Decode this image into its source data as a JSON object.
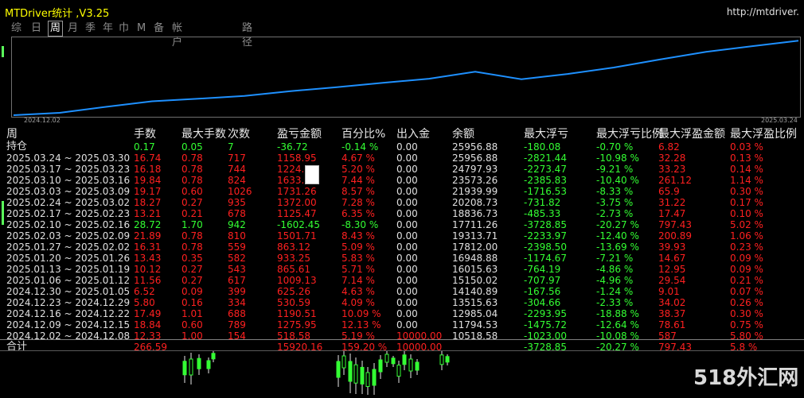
{
  "app": {
    "title": "MTDriver统计 ,V3.25",
    "url": "http://mtdriver."
  },
  "tabs": [
    {
      "label": "综",
      "active": false
    },
    {
      "label": "日",
      "active": false
    },
    {
      "label": "周",
      "active": true
    },
    {
      "label": "月",
      "active": false
    },
    {
      "label": "季",
      "active": false
    },
    {
      "label": "年",
      "active": false
    },
    {
      "label": "巾",
      "active": false
    },
    {
      "label": "M",
      "active": false
    },
    {
      "label": "备",
      "active": false
    },
    {
      "label": "帐户",
      "active": false
    },
    {
      "label": "路径",
      "active": false
    }
  ],
  "chart_data": {
    "type": "line",
    "x_start_label": "2024.12.02",
    "x_end_label": "2025.03.24",
    "x": [
      "2024.12.02",
      "2024.12.09",
      "2024.12.16",
      "2024.12.23",
      "2024.12.30",
      "2025.01.06",
      "2025.01.13",
      "2025.01.20",
      "2025.01.27",
      "2025.02.03",
      "2025.02.10",
      "2025.02.17",
      "2025.02.24",
      "2025.03.03",
      "2025.03.10",
      "2025.03.17",
      "2025.03.24"
    ],
    "values": [
      10000.0,
      10518.58,
      11794.53,
      12985.04,
      13515.63,
      14140.89,
      15150.02,
      16015.63,
      16948.88,
      17812.0,
      19313.71,
      17711.26,
      18836.73,
      20208.73,
      21939.99,
      23573.26,
      24797.93,
      25956.88
    ],
    "line_color": "#1e90ff"
  },
  "table": {
    "headers": [
      "周",
      "手数",
      "最大手数",
      "次数",
      "盈亏金额",
      "百分比%",
      "出入金",
      "余额",
      "最大浮亏",
      "最大浮亏比例",
      "最大浮盈金额",
      "最大浮盈比例"
    ],
    "holding": {
      "label": "持仓",
      "lots": "0.17",
      "max_lots": "0.05",
      "count": "7",
      "pnl": "-36.72",
      "pct": "-0.14 %",
      "flow": "0.00",
      "balance": "25956.88",
      "max_float_loss": "-180.08",
      "max_float_loss_pct": "-0.70 %",
      "max_float_profit": "6.82",
      "max_float_profit_pct": "0.03 %"
    },
    "rows": [
      {
        "period": "2025.03.24 ~ 2025.03.30",
        "lots": "16.74",
        "max_lots": "0.78",
        "count": "717",
        "pnl": "1158.95",
        "pct": "4.67 %",
        "flow": "0.00",
        "balance": "25956.88",
        "max_float_loss": "-2821.44",
        "max_float_loss_pct": "-10.98 %",
        "max_float_profit": "32.28",
        "max_float_profit_pct": "0.13 %",
        "pos": true
      },
      {
        "period": "2025.03.17 ~ 2025.03.23",
        "lots": "16.18",
        "max_lots": "0.78",
        "count": "744",
        "pnl": "1224.",
        "pct": "5.20 %",
        "flow": "0.00",
        "balance": "24797.93",
        "max_float_loss": "-2273.47",
        "max_float_loss_pct": "-9.21 %",
        "max_float_profit": "33.23",
        "max_float_profit_pct": "0.14 %",
        "pos": true
      },
      {
        "period": "2025.03.10 ~ 2025.03.16",
        "lots": "19.84",
        "max_lots": "0.78",
        "count": "824",
        "pnl": "1633.",
        "pct": "7.44 %",
        "flow": "0.00",
        "balance": "23573.26",
        "max_float_loss": "-2385.83",
        "max_float_loss_pct": "-10.40 %",
        "max_float_profit": "261.12",
        "max_float_profit_pct": "1.14 %",
        "pos": true
      },
      {
        "period": "2025.03.03 ~ 2025.03.09",
        "lots": "19.17",
        "max_lots": "0.60",
        "count": "1026",
        "pnl": "1731.26",
        "pct": "8.57 %",
        "flow": "0.00",
        "balance": "21939.99",
        "max_float_loss": "-1716.53",
        "max_float_loss_pct": "-8.33 %",
        "max_float_profit": "65.9",
        "max_float_profit_pct": "0.30 %",
        "pos": true
      },
      {
        "period": "2025.02.24 ~ 2025.03.02",
        "lots": "18.27",
        "max_lots": "0.27",
        "count": "935",
        "pnl": "1372.00",
        "pct": "7.28 %",
        "flow": "0.00",
        "balance": "20208.73",
        "max_float_loss": "-731.82",
        "max_float_loss_pct": "-3.75 %",
        "max_float_profit": "31.22",
        "max_float_profit_pct": "0.17 %",
        "pos": true
      },
      {
        "period": "2025.02.17 ~ 2025.02.23",
        "lots": "13.21",
        "max_lots": "0.21",
        "count": "678",
        "pnl": "1125.47",
        "pct": "6.35 %",
        "flow": "0.00",
        "balance": "18836.73",
        "max_float_loss": "-485.33",
        "max_float_loss_pct": "-2.73 %",
        "max_float_profit": "17.47",
        "max_float_profit_pct": "0.10 %",
        "pos": true
      },
      {
        "period": "2025.02.10 ~ 2025.02.16",
        "lots": "28.72",
        "max_lots": "1.70",
        "count": "942",
        "pnl": "-1602.45",
        "pct": "-8.30 %",
        "flow": "0.00",
        "balance": "17711.26",
        "max_float_loss": "-3728.85",
        "max_float_loss_pct": "-20.27 %",
        "max_float_profit": "797.43",
        "max_float_profit_pct": "5.02 %",
        "pos": false
      },
      {
        "period": "2025.02.03 ~ 2025.02.09",
        "lots": "21.89",
        "max_lots": "0.78",
        "count": "810",
        "pnl": "1501.71",
        "pct": "8.43 %",
        "flow": "0.00",
        "balance": "19313.71",
        "max_float_loss": "-2233.97",
        "max_float_loss_pct": "-12.40 %",
        "max_float_profit": "200.89",
        "max_float_profit_pct": "1.06 %",
        "pos": true
      },
      {
        "period": "2025.01.27 ~ 2025.02.02",
        "lots": "16.31",
        "max_lots": "0.78",
        "count": "559",
        "pnl": "863.12",
        "pct": "5.09 %",
        "flow": "0.00",
        "balance": "17812.00",
        "max_float_loss": "-2398.50",
        "max_float_loss_pct": "-13.69 %",
        "max_float_profit": "39.93",
        "max_float_profit_pct": "0.23 %",
        "pos": true
      },
      {
        "period": "2025.01.20 ~ 2025.01.26",
        "lots": "13.43",
        "max_lots": "0.35",
        "count": "582",
        "pnl": "933.25",
        "pct": "5.83 %",
        "flow": "0.00",
        "balance": "16948.88",
        "max_float_loss": "-1174.67",
        "max_float_loss_pct": "-7.21 %",
        "max_float_profit": "14.67",
        "max_float_profit_pct": "0.09 %",
        "pos": true
      },
      {
        "period": "2025.01.13 ~ 2025.01.19",
        "lots": "10.12",
        "max_lots": "0.27",
        "count": "543",
        "pnl": "865.61",
        "pct": "5.71 %",
        "flow": "0.00",
        "balance": "16015.63",
        "max_float_loss": "-764.19",
        "max_float_loss_pct": "-4.86 %",
        "max_float_profit": "12.95",
        "max_float_profit_pct": "0.09 %",
        "pos": true
      },
      {
        "period": "2025.01.06 ~ 2025.01.12",
        "lots": "11.56",
        "max_lots": "0.27",
        "count": "617",
        "pnl": "1009.13",
        "pct": "7.14 %",
        "flow": "0.00",
        "balance": "15150.02",
        "max_float_loss": "-707.97",
        "max_float_loss_pct": "-4.96 %",
        "max_float_profit": "29.54",
        "max_float_profit_pct": "0.21 %",
        "pos": true
      },
      {
        "period": "2024.12.30 ~ 2025.01.05",
        "lots": "6.52",
        "max_lots": "0.09",
        "count": "399",
        "pnl": "625.26",
        "pct": "4.63 %",
        "flow": "0.00",
        "balance": "14140.89",
        "max_float_loss": "-167.56",
        "max_float_loss_pct": "-1.24 %",
        "max_float_profit": "9.01",
        "max_float_profit_pct": "0.07 %",
        "pos": true
      },
      {
        "period": "2024.12.23 ~ 2024.12.29",
        "lots": "5.80",
        "max_lots": "0.16",
        "count": "334",
        "pnl": "530.59",
        "pct": "4.09 %",
        "flow": "0.00",
        "balance": "13515.63",
        "max_float_loss": "-304.66",
        "max_float_loss_pct": "-2.33 %",
        "max_float_profit": "34.02",
        "max_float_profit_pct": "0.26 %",
        "pos": true
      },
      {
        "period": "2024.12.16 ~ 2024.12.22",
        "lots": "17.49",
        "max_lots": "1.01",
        "count": "688",
        "pnl": "1190.51",
        "pct": "10.09 %",
        "flow": "0.00",
        "balance": "12985.04",
        "max_float_loss": "-2293.95",
        "max_float_loss_pct": "-18.88 %",
        "max_float_profit": "38.37",
        "max_float_profit_pct": "0.30 %",
        "pos": true
      },
      {
        "period": "2024.12.09 ~ 2024.12.15",
        "lots": "18.84",
        "max_lots": "0.60",
        "count": "789",
        "pnl": "1275.95",
        "pct": "12.13 %",
        "flow": "0.00",
        "balance": "11794.53",
        "max_float_loss": "-1475.72",
        "max_float_loss_pct": "-12.64 %",
        "max_float_profit": "78.61",
        "max_float_profit_pct": "0.75 %",
        "pos": true
      },
      {
        "period": "2024.12.02 ~ 2024.12.08",
        "lots": "12.33",
        "max_lots": "1.00",
        "count": "154",
        "pnl": "518.58",
        "pct": "5.19 %",
        "flow": "10000.00",
        "balance": "10518.58",
        "max_float_loss": "-1023.00",
        "max_float_loss_pct": "-10.08 %",
        "max_float_profit": "587",
        "max_float_profit_pct": "5.80 %",
        "pos": true
      }
    ],
    "total": {
      "label": "合计",
      "lots": "266.59",
      "pnl": "15920.16",
      "pct": "159.20 %",
      "flow": "10000.00",
      "max_float_loss": "-3728.85",
      "max_float_loss_pct": "-20.27 %",
      "max_float_profit": "797.43",
      "max_float_profit_pct": "5.8 %"
    }
  },
  "watermark": "518外汇网",
  "colors": {
    "positive": "#ff2020",
    "negative": "#33ff33",
    "text": "#e0e0e0",
    "line": "#1e90ff",
    "title": "#ffff00"
  }
}
